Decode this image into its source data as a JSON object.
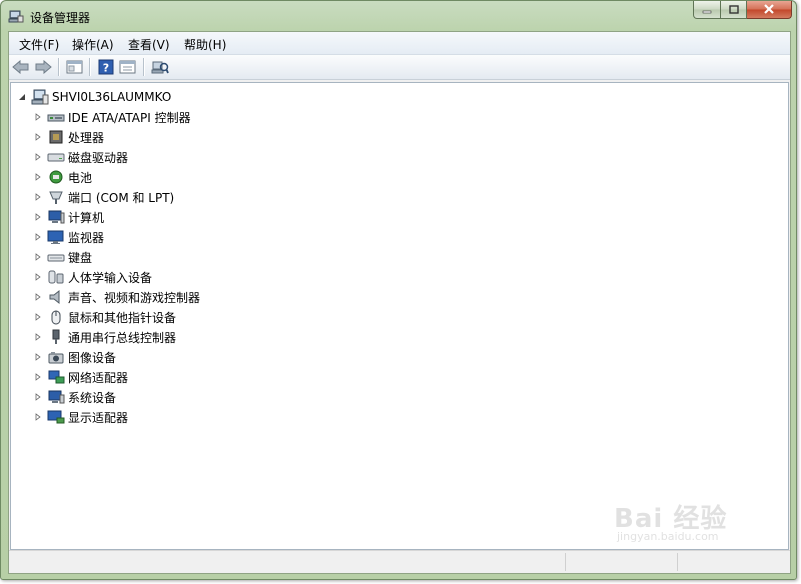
{
  "window": {
    "title": "设备管理器"
  },
  "menu": {
    "items": [
      "文件(F)",
      "操作(A)",
      "查看(V)",
      "帮助(H)"
    ]
  },
  "toolbar": {
    "buttons": [
      "back-arrow-icon",
      "forward-arrow-icon",
      "properties-icon",
      "help-icon",
      "view-icon",
      "scan-hardware-icon"
    ]
  },
  "tree": {
    "root": "SHVI0L36LAUMMKO",
    "items": [
      {
        "label": "IDE ATA/ATAPI 控制器",
        "icon": "ide-controller-icon"
      },
      {
        "label": "处理器",
        "icon": "processor-icon"
      },
      {
        "label": "磁盘驱动器",
        "icon": "disk-drive-icon"
      },
      {
        "label": "电池",
        "icon": "battery-icon"
      },
      {
        "label": "端口 (COM 和 LPT)",
        "icon": "port-icon"
      },
      {
        "label": "计算机",
        "icon": "computer-icon"
      },
      {
        "label": "监视器",
        "icon": "monitor-icon"
      },
      {
        "label": "键盘",
        "icon": "keyboard-icon"
      },
      {
        "label": "人体学输入设备",
        "icon": "hid-icon"
      },
      {
        "label": "声音、视频和游戏控制器",
        "icon": "speaker-icon"
      },
      {
        "label": "鼠标和其他指针设备",
        "icon": "mouse-icon"
      },
      {
        "label": "通用串行总线控制器",
        "icon": "usb-icon"
      },
      {
        "label": "图像设备",
        "icon": "camera-icon"
      },
      {
        "label": "网络适配器",
        "icon": "network-adapter-icon"
      },
      {
        "label": "系统设备",
        "icon": "system-device-icon"
      },
      {
        "label": "显示适配器",
        "icon": "display-adapter-icon"
      }
    ]
  },
  "watermark": {
    "text": "Bai 经验",
    "sub": "jingyan.baidu.com"
  },
  "colors": {
    "frame": "#b7cfa6",
    "close": "#c2462a"
  }
}
